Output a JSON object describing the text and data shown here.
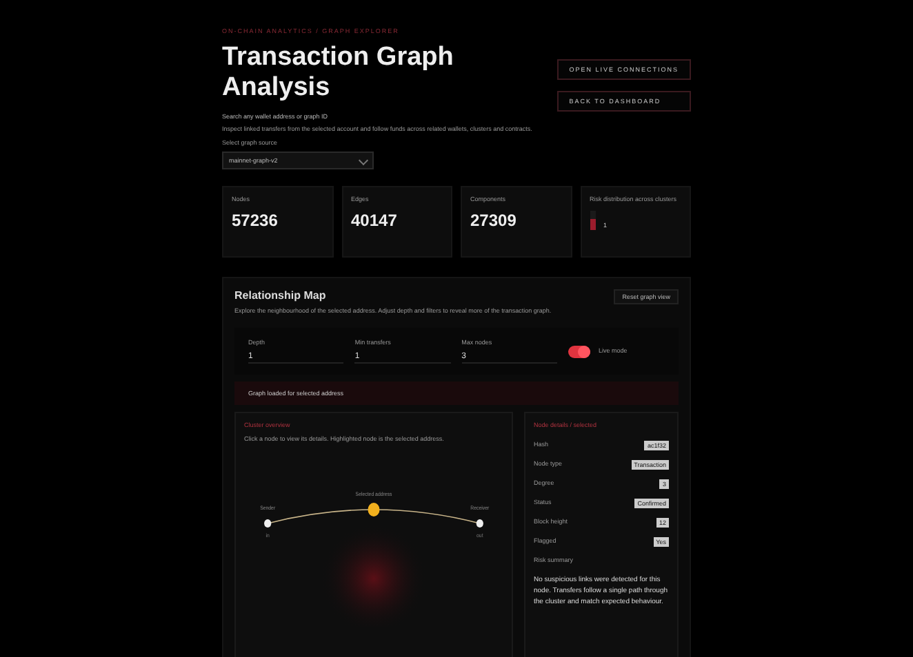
{
  "eyebrow": "ON-CHAIN ANALYTICS / GRAPH EXPLORER",
  "title": "Transaction Graph Analysis",
  "subtitle": "Search any wallet address or graph ID",
  "description": "Inspect linked transfers from the selected account and follow funds across related wallets, clusters and contracts.",
  "select": {
    "label": "Select graph source",
    "value": "mainnet-graph-v2"
  },
  "buttons": [
    {
      "label": "OPEN LIVE CONNECTIONS"
    },
    {
      "label": "BACK TO DASHBOARD"
    }
  ],
  "stats": [
    {
      "label": "Nodes",
      "value": "57236",
      "kind": "number"
    },
    {
      "label": "Edges",
      "value": "40147",
      "kind": "number"
    },
    {
      "label": "Components",
      "value": "27309",
      "kind": "number"
    },
    {
      "label": "Risk distribution across clusters",
      "value": "1",
      "kind": "bar",
      "level": 0.6
    }
  ],
  "map": {
    "title": "Relationship Map",
    "description": "Explore the neighbourhood of the selected address. Adjust depth and filters to reveal more of the transaction graph.",
    "action": "Reset graph view",
    "inputs": [
      {
        "label": "Depth",
        "value": "1"
      },
      {
        "label": "Min transfers",
        "value": "1"
      },
      {
        "label": "Max nodes",
        "value": "3"
      }
    ],
    "toggle": {
      "label": "Live mode",
      "on": true
    },
    "banner": "Graph loaded for selected address",
    "graph": {
      "title": "Cluster overview",
      "description": "Click a node to view its details. Highlighted node is the selected address.",
      "nodes": [
        {
          "label": "Sender",
          "note": "in",
          "kind": "wallet"
        },
        {
          "label": "Selected address",
          "kind": "focus"
        },
        {
          "label": "Receiver",
          "note": "out",
          "kind": "wallet"
        }
      ]
    },
    "details": {
      "title": "Node details / selected",
      "rows": [
        {
          "label": "Hash",
          "value": "ac1f32"
        },
        {
          "label": "Node type",
          "value": "Transaction"
        },
        {
          "label": "Degree",
          "value": "3"
        },
        {
          "label": "Status",
          "value": "Confirmed"
        },
        {
          "label": "Block height",
          "value": "12"
        },
        {
          "label": "Flagged",
          "value": "Yes"
        }
      ],
      "note_title": "Risk summary",
      "note": "No suspicious links were detected for this node. Transfers follow a single path through the cluster and match expected behaviour."
    }
  }
}
